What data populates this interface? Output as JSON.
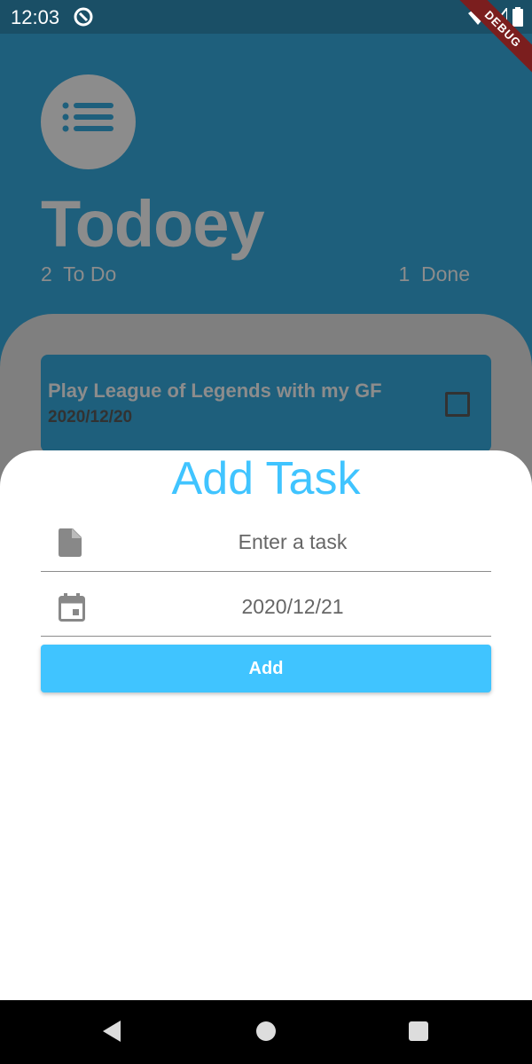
{
  "status_bar": {
    "time": "12:03",
    "debug_label": "DEBUG",
    "icons": [
      "app-notification-icon",
      "wifi-icon",
      "signal-icon",
      "battery-icon"
    ]
  },
  "app": {
    "title": "Todoey",
    "todo_count": "2",
    "todo_label": "To Do",
    "done_count": "1",
    "done_label": "Done",
    "tasks": [
      {
        "title": "Play League of Legends with my GF",
        "date": "2020/12/20",
        "checked": false
      }
    ]
  },
  "add_task_sheet": {
    "title": "Add Task",
    "task_field": {
      "placeholder": "Enter a task",
      "icon": "file-icon"
    },
    "date_field": {
      "value": "2020/12/21",
      "icon": "calendar-icon"
    },
    "add_label": "Add"
  },
  "colors": {
    "accent": "#40c4ff",
    "primary_dimmed": "#1e5f7c",
    "scrim_grey": "#8c8c8c"
  },
  "nav_bar": {
    "buttons": [
      "back-icon",
      "home-icon",
      "recents-icon"
    ]
  }
}
